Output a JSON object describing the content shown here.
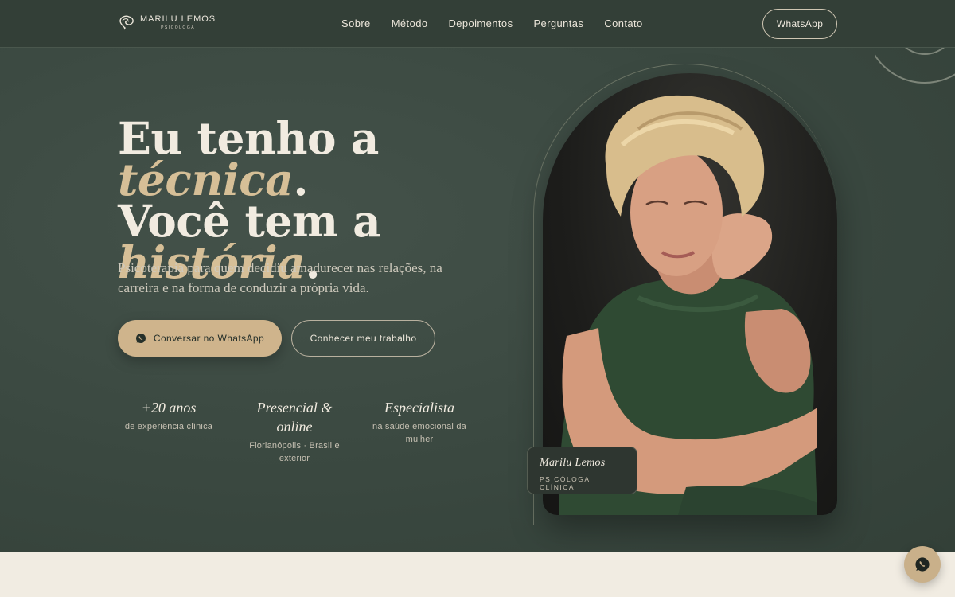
{
  "brand": {
    "name": "MARILU LEMOS",
    "subtitle": "PSICÓLOGA"
  },
  "nav": {
    "items": [
      {
        "label": "Sobre"
      },
      {
        "label": "Método"
      },
      {
        "label": "Depoimentos"
      },
      {
        "label": "Perguntas"
      },
      {
        "label": "Contato"
      }
    ],
    "cta_label": "WhatsApp"
  },
  "hero": {
    "headline_part1": "Eu tenho a ",
    "headline_accent1": "técnica",
    "headline_part2": ".",
    "headline_part3": "Você tem a",
    "headline_accent2": "história",
    "headline_part4": ".",
    "lead": "Psicoterapia para quem decidiu amadurecer nas relações, na carreira e na forma de conduzir a própria vida.",
    "primary_label": "Conversar no WhatsApp",
    "secondary_label": "Conhecer meu trabalho",
    "stats": [
      {
        "title": "+20 anos",
        "text": "de experiência clínica"
      },
      {
        "title": "Presencial & online",
        "text": "Florianópolis · Brasil e",
        "text_link": "exterior"
      },
      {
        "title": "Especialista",
        "text": "na saúde emocional da mulher"
      }
    ]
  },
  "portrait": {
    "name": "Marilu Lemos",
    "role": "PSICÓLOGA CLÍNICA"
  },
  "colors": {
    "accent": "#cfb48c",
    "background": "#3a4840",
    "text": "#f1ebe0",
    "band": "#f1ece2"
  },
  "icons": [
    "whatsapp-icon",
    "brain-logo-icon"
  ]
}
